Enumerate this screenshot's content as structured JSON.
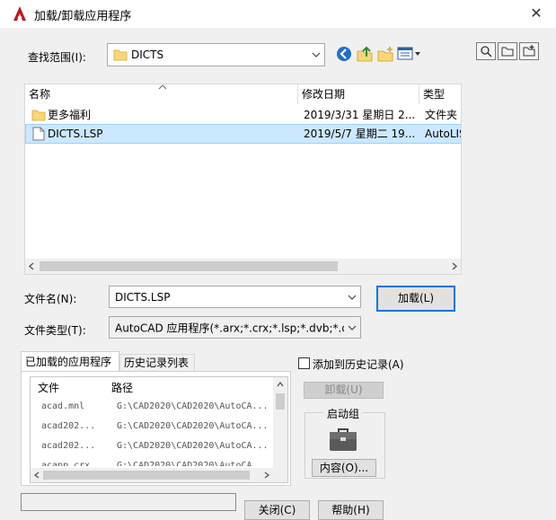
{
  "window": {
    "title": "加载/卸载应用程序",
    "close": "✕"
  },
  "lookin": {
    "label": "查找范围(I):",
    "value": "DICTS"
  },
  "filelist": {
    "columns": [
      "名称",
      "修改日期",
      "类型"
    ],
    "rows": [
      {
        "name": "更多福利",
        "date": "2019/3/31 星期日 2...",
        "type": "文件夹",
        "icon": "folder-icon"
      },
      {
        "name": "DICTS.LSP",
        "date": "2019/5/7 星期二 19...",
        "type": "AutoLIS",
        "icon": "file-icon"
      }
    ],
    "selected_row": 1
  },
  "filename": {
    "label": "文件名(N):",
    "value": "DICTS.LSP"
  },
  "filetype": {
    "label": "文件类型(T):",
    "value": "AutoCAD 应用程序(*.arx;*.crx;*.lsp;*.dvb;*.dbx"
  },
  "load_button": "加载(L)",
  "tabs": [
    "已加载的应用程序",
    "历史记录列表"
  ],
  "loaded_apps": {
    "columns": [
      "文件",
      "路径"
    ],
    "rows": [
      {
        "file": "acad.mnl",
        "path": "G:\\CAD2020\\CAD2020\\AutoCA..."
      },
      {
        "file": "acad202...",
        "path": "G:\\CAD2020\\CAD2020\\AutoCA..."
      },
      {
        "file": "acad202...",
        "path": "G:\\CAD2020\\CAD2020\\AutoCA..."
      },
      {
        "file": "acapp.crx",
        "path": "G:\\CAD2020\\CAD2020\\AutoCA..."
      }
    ]
  },
  "add_history": {
    "label": "添加到历史记录(A)",
    "checked": false
  },
  "unload_button": "卸载(U)",
  "startup": {
    "label": "启动组",
    "contents_button": "内容(O)..."
  },
  "bottom_buttons": [
    "关闭(C)",
    "帮助(H)"
  ],
  "colors": {
    "accent": "#0078d7",
    "selection": "#cce8ff",
    "folder": "#f8d775",
    "logo": "#c4161c"
  }
}
